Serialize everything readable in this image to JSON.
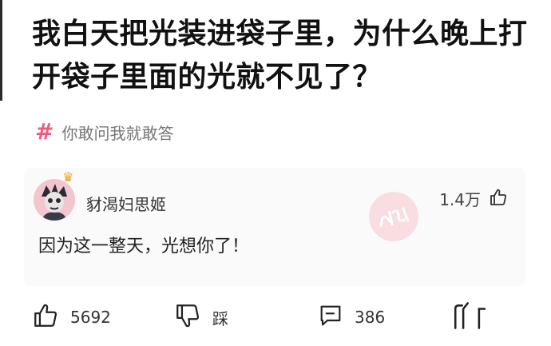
{
  "question": {
    "title": "我白天把光装进袋子里，为什么晚上打开袋子里面的光就不见了？"
  },
  "topic": {
    "label": "你敢问我就敢答",
    "icon": "hash-icon",
    "color": "#f05a7e"
  },
  "answer": {
    "author": "豺渴妇思姬",
    "like_count": "1.4万",
    "text": "因为这一整天，光想你了！"
  },
  "actions": {
    "like_count": "5692",
    "dislike_label": "踩",
    "comment_count": "386"
  }
}
